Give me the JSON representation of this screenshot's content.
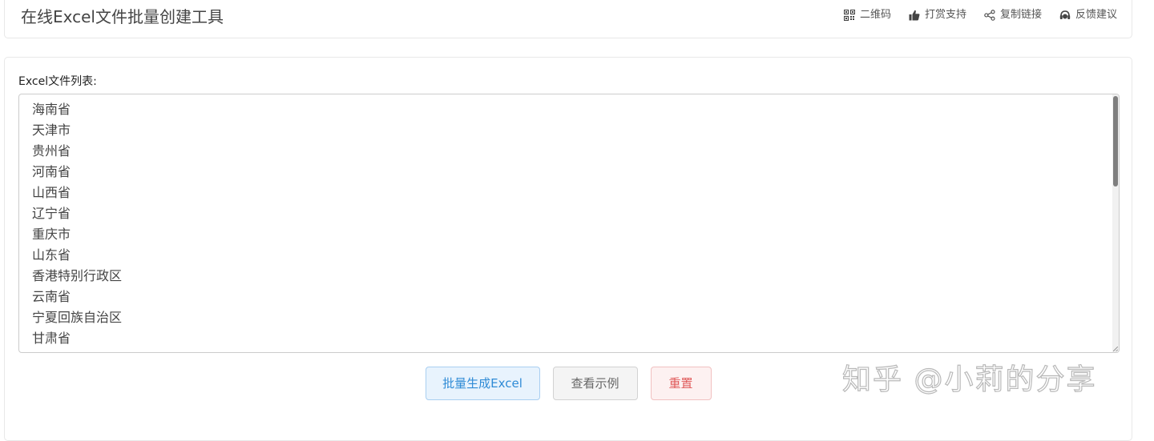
{
  "header": {
    "title": "在线Excel文件批量创建工具",
    "actions": [
      {
        "label": "二维码",
        "icon": "qr-code-icon"
      },
      {
        "label": "打赏支持",
        "icon": "thumbs-up-icon"
      },
      {
        "label": "复制链接",
        "icon": "share-icon"
      },
      {
        "label": "反馈建议",
        "icon": "headset-icon"
      }
    ]
  },
  "main": {
    "list_label": "Excel文件列表:",
    "file_names": "海南省\n天津市\n贵州省\n河南省\n山西省\n辽宁省\n重庆市\n山东省\n香港特别行政区\n云南省\n宁夏回族自治区\n甘肃省",
    "buttons": {
      "generate": "批量生成Excel",
      "example": "查看示例",
      "reset": "重置"
    }
  },
  "watermark": "知乎 @小莉的分享",
  "colors": {
    "primary": "#2f8bd6",
    "danger": "#e05a5a",
    "border": "#e8e8e8"
  }
}
